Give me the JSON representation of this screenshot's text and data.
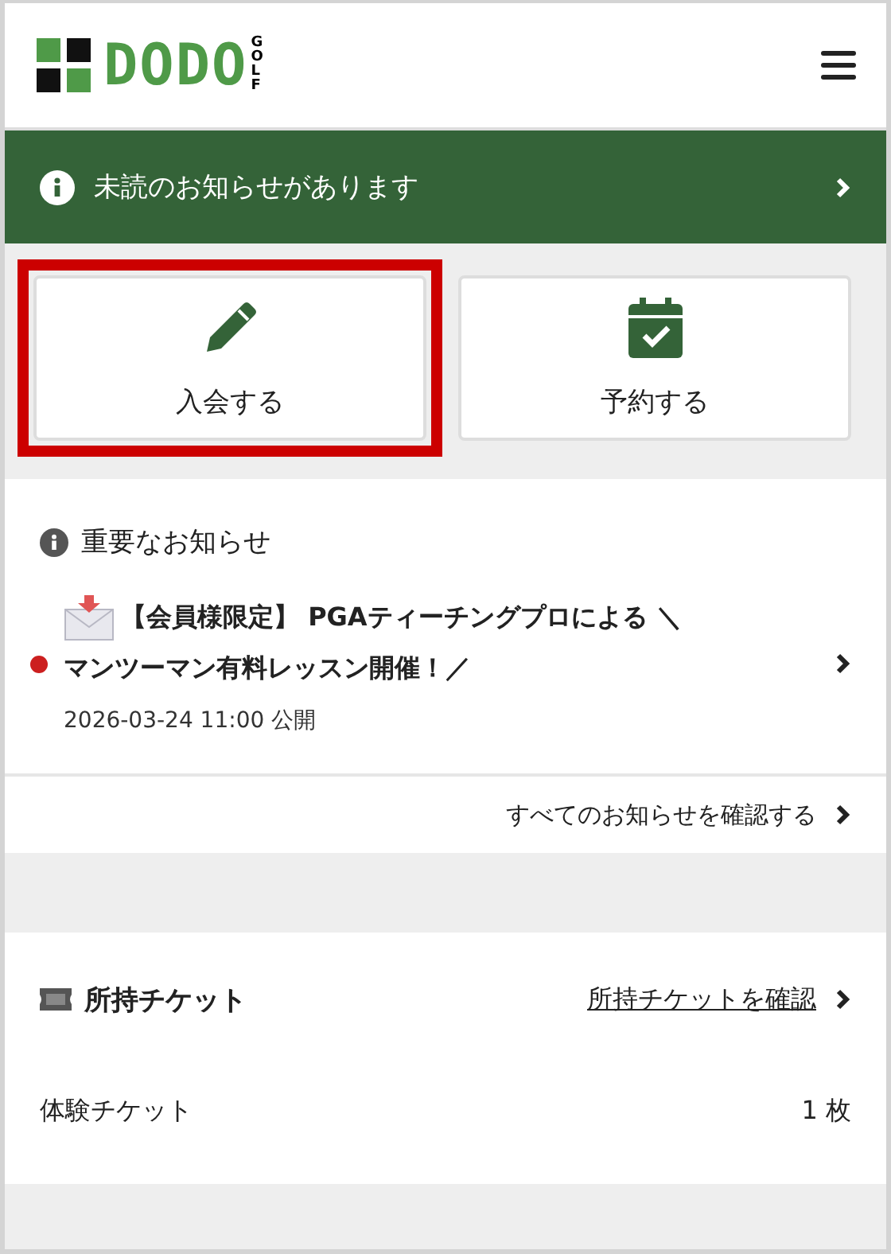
{
  "header": {
    "logo": {
      "text": "DODO",
      "sub": "GOLF"
    }
  },
  "banner": {
    "text": "未読のお知らせがあります"
  },
  "actions": [
    {
      "label": "入会する",
      "kind": "pencil",
      "highlighted": true
    },
    {
      "label": "予約する",
      "kind": "calendar",
      "highlighted": false
    }
  ],
  "notices": {
    "title": "重要なお知らせ",
    "items": [
      {
        "title_lines": [
          "【会員様限定】 PGAティーチングプロによる ＼",
          "マンツーマン有料レッスン開催！／"
        ],
        "date": "2026-03-24 11:00 公開",
        "unread": true
      }
    ],
    "all_link": "すべてのお知らせを確認する"
  },
  "tickets": {
    "title": "所持チケット",
    "link": "所持チケットを確認",
    "rows": [
      {
        "name": "体験チケット",
        "count": "1 枚"
      }
    ]
  }
}
